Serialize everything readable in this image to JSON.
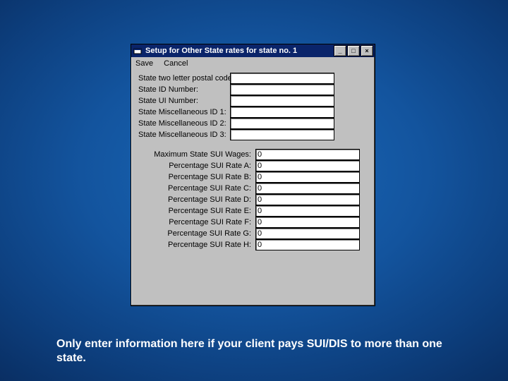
{
  "window": {
    "title": "Setup for Other State rates for state no. 1"
  },
  "menu": {
    "save": "Save",
    "cancel": "Cancel"
  },
  "group1": {
    "postal_label": "State two letter postal code:",
    "postal_value": "",
    "id_label": "State ID Number:",
    "id_value": "",
    "ui_label": "State UI Number:",
    "ui_value": "",
    "misc1_label": "State Miscellaneous ID 1:",
    "misc1_value": "",
    "misc2_label": "State Miscellaneous ID 2:",
    "misc2_value": "",
    "misc3_label": "State Miscellaneous ID 3:",
    "misc3_value": ""
  },
  "group2": {
    "maxwages_label": "Maximum State SUI Wages:",
    "maxwages_value": "0",
    "rateA_label": "Percentage SUI Rate A:",
    "rateA_value": "0",
    "rateB_label": "Percentage SUI Rate B:",
    "rateB_value": "0",
    "rateC_label": "Percentage SUI Rate C:",
    "rateC_value": "0",
    "rateD_label": "Percentage SUI Rate D:",
    "rateD_value": "0",
    "rateE_label": "Percentage SUI Rate E:",
    "rateE_value": "0",
    "rateF_label": "Percentage SUI Rate F:",
    "rateF_value": "0",
    "rateG_label": "Percentage SUI Rate G:",
    "rateG_value": "0",
    "rateH_label": "Percentage SUI Rate H:",
    "rateH_value": "0"
  },
  "caption": "Only enter information here if your client pays SUI/DIS to more than one state."
}
